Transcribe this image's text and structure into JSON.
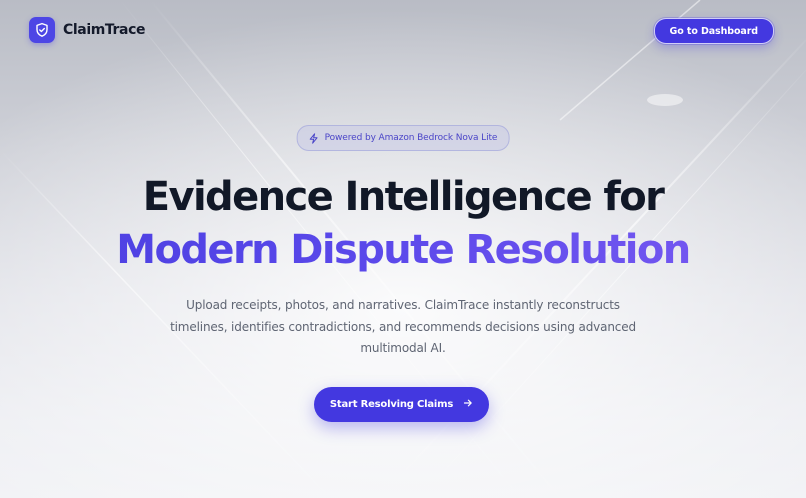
{
  "header": {
    "brand": "ClaimTrace",
    "logo_icon": "shield-check-icon",
    "dashboard_button": "Go to Dashboard"
  },
  "hero": {
    "badge": {
      "icon": "lightning-bolt-icon",
      "text": "Powered by Amazon Bedrock Nova Lite"
    },
    "headline_line1": "Evidence Intelligence for",
    "headline_line2": "Modern Dispute Resolution",
    "subtitle_lines": [
      "Upload receipts, photos, and narratives. ClaimTrace instantly reconstructs",
      "timelines, identifies contradictions, and recommends decisions using advanced",
      "multimodal AI."
    ],
    "cta": {
      "label": "Start Resolving Claims",
      "icon": "arrow-right-icon"
    }
  },
  "colors": {
    "accent": "#4338e0",
    "headline_dark": "#111827",
    "gradient_start": "#4a3fe0",
    "gradient_end": "#7a5bf2",
    "subtitle": "#5f6573"
  }
}
